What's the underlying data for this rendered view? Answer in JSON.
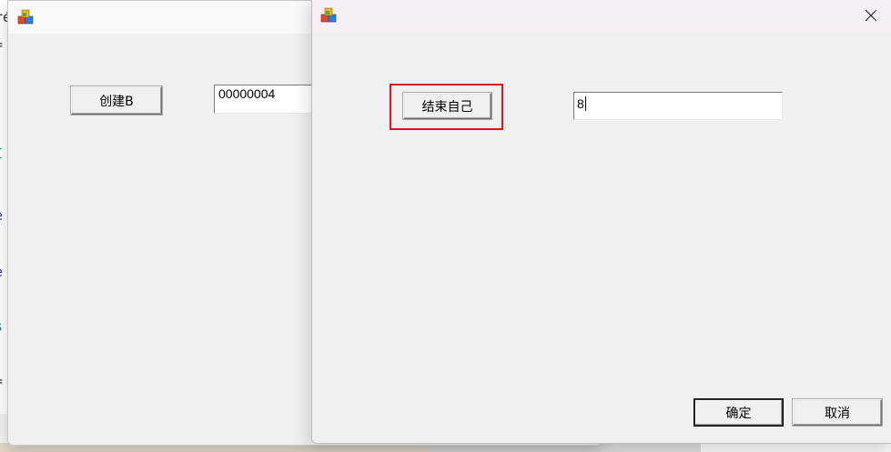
{
  "background_window": {
    "create_button_label": "创建B",
    "value_field": "00000004"
  },
  "dialog": {
    "end_self_button_label": "结束自己",
    "input_value": "8",
    "ok_label": "确定",
    "cancel_label": "取消",
    "highlight_color": "#e0141e"
  },
  "icons": {
    "app": "app-blocks-icon",
    "close": "close-icon"
  }
}
